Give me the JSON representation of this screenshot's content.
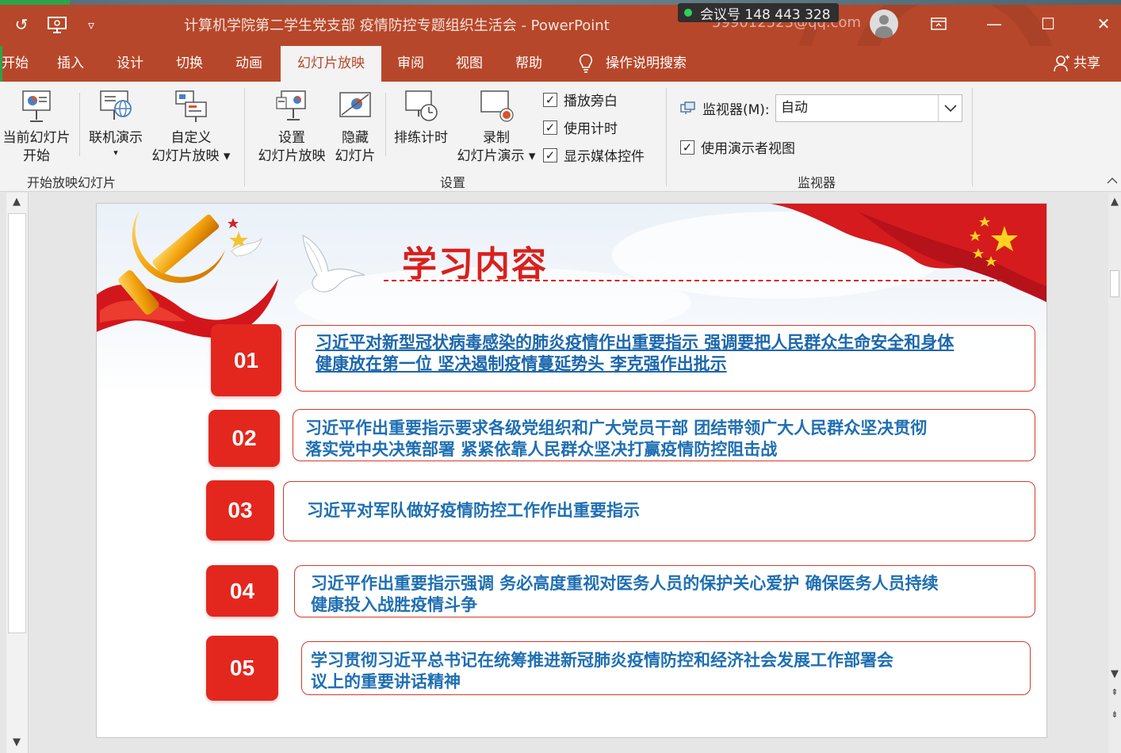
{
  "window": {
    "title": "计算机学院第二学生党支部 疫情防控专题组织生活会  -  PowerPoint",
    "account": "599012523@qq.com",
    "meeting": {
      "text": "会议号 148 443 328"
    }
  },
  "quick_access": {
    "undo_icon": "↺",
    "present_icon": "⊡",
    "more_icon": "▿"
  },
  "window_controls": {
    "ribbon_display": "⊡",
    "minimize": "—",
    "maximize": "☐",
    "close": "✕"
  },
  "tabs": [
    {
      "label": "开始"
    },
    {
      "label": "插入"
    },
    {
      "label": "设计"
    },
    {
      "label": "切换"
    },
    {
      "label": "动画"
    },
    {
      "label": "幻灯片放映"
    },
    {
      "label": "审阅"
    },
    {
      "label": "视图"
    },
    {
      "label": "帮助"
    }
  ],
  "tell_me": "操作说明搜索",
  "share": "共享",
  "ribbon": {
    "start_group": {
      "label": "开始放映幻灯片",
      "from_current": {
        "line1": "当前幻灯片",
        "line2": "开始"
      },
      "online": {
        "line1": "联机演示",
        "line2": "▾"
      },
      "custom": {
        "line1": "自定义",
        "line2": "幻灯片放映 ▾"
      }
    },
    "setup_group": {
      "label": "设置",
      "setup_show": {
        "line1": "设置",
        "line2": "幻灯片放映"
      },
      "hide_slide": {
        "line1": "隐藏",
        "line2": "幻灯片"
      },
      "rehearse": {
        "line1": "排练计时"
      },
      "record": {
        "line1": "录制",
        "line2": "幻灯片演示 ▾"
      },
      "checks": [
        {
          "label": "播放旁白",
          "checked": true
        },
        {
          "label": "使用计时",
          "checked": true
        },
        {
          "label": "显示媒体控件",
          "checked": true
        }
      ]
    },
    "monitor_group": {
      "label": "监视器",
      "monitor_label": "监视器(M):",
      "monitor_value": "自动",
      "presenter_view": {
        "label": "使用演示者视图",
        "checked": true
      }
    }
  },
  "slide": {
    "title": "学习内容",
    "items": [
      {
        "num": "01",
        "line1": "习近平对新型冠状病毒感染的肺炎疫情作出重要指示 强调要把人民群众生命安全和身体",
        "line2": "健康放在第一位 坚决遏制疫情蔓延势头 李克强作出批示"
      },
      {
        "num": "02",
        "line1": "习近平作出重要指示要求各级党组织和广大党员干部 团结带领广大人民群众坚决贯彻",
        "line2": "落实党中央决策部署 紧紧依靠人民群众坚决打赢疫情防控阻击战"
      },
      {
        "num": "03",
        "line1": "习近平对军队做好疫情防控工作作出重要指示",
        "line2": ""
      },
      {
        "num": "04",
        "line1": "习近平作出重要指示强调 务必高度重视对医务人员的保护关心爱护 确保医务人员持续",
        "line2": "健康投入战胜疫情斗争"
      },
      {
        "num": "05",
        "line1": "学习贯彻习近平总书记在统筹推进新冠肺炎疫情防控和经济社会发展工作部署会",
        "line2": "议上的重要讲话精神"
      }
    ]
  },
  "colors": {
    "accent": "#b7472a",
    "slide_red": "#e3271e",
    "text_blue": "#1f6fb2"
  }
}
